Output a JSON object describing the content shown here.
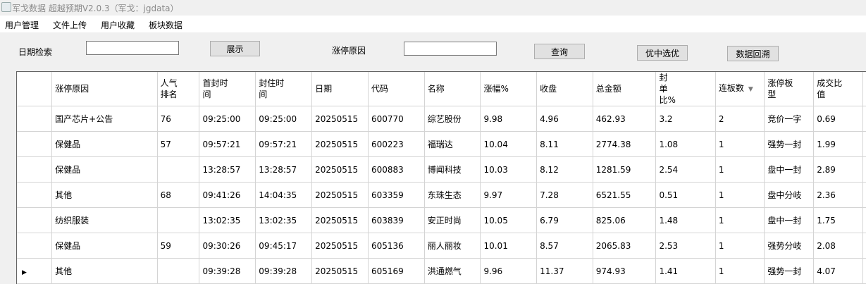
{
  "window": {
    "title": "军戈数据 超越预期V2.0.3（军戈：jgdata）"
  },
  "menu": [
    {
      "label": "用户管理"
    },
    {
      "label": "文件上传"
    },
    {
      "label": "用户收藏"
    },
    {
      "label": "板块数据"
    }
  ],
  "toolbar": {
    "date_label": "日期检索",
    "date_value": "",
    "show_button": "展示",
    "reason_label": "涨停原因",
    "reason_value": "",
    "query_button": "查询",
    "pick_button": "优中选优",
    "backtest_button": "数据回溯"
  },
  "table": {
    "columns": [
      {
        "label": "涨停原因"
      },
      {
        "label": "人气排名"
      },
      {
        "label": "首封时间"
      },
      {
        "label": "封住时间"
      },
      {
        "label": "日期"
      },
      {
        "label": "代码"
      },
      {
        "label": "名称"
      },
      {
        "label": "涨幅%"
      },
      {
        "label": "收盘"
      },
      {
        "label": "总金额"
      },
      {
        "label": "封单比%"
      },
      {
        "label": "连板数",
        "sorted": "down"
      },
      {
        "label": "涨停板型"
      },
      {
        "label": "成交比值"
      }
    ],
    "rows": [
      {
        "reason": "国产芯片+公告",
        "rank": "76",
        "first_seal": "09:25:00",
        "final_seal": "09:25:00",
        "date": "20250515",
        "code": "600770",
        "name": "综艺股份",
        "change": "9.98",
        "close": "4.96",
        "amount": "462.93",
        "seal_ratio": "3.2",
        "boards": "2",
        "board_type": "竞价一字",
        "volume_ratio": "0.69",
        "current": false
      },
      {
        "reason": "保健品",
        "rank": "57",
        "first_seal": "09:57:21",
        "final_seal": "09:57:21",
        "date": "20250515",
        "code": "600223",
        "name": "福瑞达",
        "change": "10.04",
        "close": "8.11",
        "amount": "2774.38",
        "seal_ratio": "1.08",
        "boards": "1",
        "board_type": "强势一封",
        "volume_ratio": "1.99",
        "current": false
      },
      {
        "reason": "保健品",
        "rank": "",
        "first_seal": "13:28:57",
        "final_seal": "13:28:57",
        "date": "20250515",
        "code": "600883",
        "name": "博闻科技",
        "change": "10.03",
        "close": "8.12",
        "amount": "1281.59",
        "seal_ratio": "2.54",
        "boards": "1",
        "board_type": "盘中一封",
        "volume_ratio": "2.89",
        "current": false
      },
      {
        "reason": "其他",
        "rank": "68",
        "first_seal": "09:41:26",
        "final_seal": "14:04:35",
        "date": "20250515",
        "code": "603359",
        "name": "东珠生态",
        "change": "9.97",
        "close": "7.28",
        "amount": "6521.55",
        "seal_ratio": "0.51",
        "boards": "1",
        "board_type": "盘中分岐",
        "volume_ratio": "2.36",
        "current": false
      },
      {
        "reason": "纺织服装",
        "rank": "",
        "first_seal": "13:02:35",
        "final_seal": "13:02:35",
        "date": "20250515",
        "code": "603839",
        "name": "安正时尚",
        "change": "10.05",
        "close": "6.79",
        "amount": "825.06",
        "seal_ratio": "1.48",
        "boards": "1",
        "board_type": "盘中一封",
        "volume_ratio": "1.75",
        "current": false
      },
      {
        "reason": "保健品",
        "rank": "59",
        "first_seal": "09:30:26",
        "final_seal": "09:45:17",
        "date": "20250515",
        "code": "605136",
        "name": "丽人丽妆",
        "change": "10.01",
        "close": "8.57",
        "amount": "2065.83",
        "seal_ratio": "2.53",
        "boards": "1",
        "board_type": "强势分岐",
        "volume_ratio": "2.08",
        "current": false
      },
      {
        "reason": "其他",
        "rank": "",
        "first_seal": "09:39:28",
        "final_seal": "09:39:28",
        "date": "20250515",
        "code": "605169",
        "name": "洪通燃气",
        "change": "9.96",
        "close": "11.37",
        "amount": "974.93",
        "seal_ratio": "1.41",
        "boards": "1",
        "board_type": "强势一封",
        "volume_ratio": "4.07",
        "current": true
      }
    ]
  },
  "icons": {
    "app": "app-icon",
    "current_row": "triangle-right-icon",
    "sort": "sort-down-icon"
  }
}
